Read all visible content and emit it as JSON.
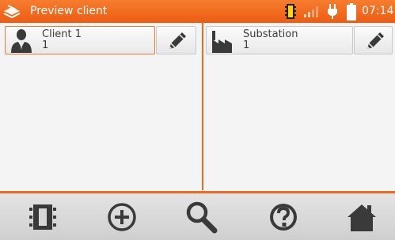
{
  "header": {
    "title": "Preview client",
    "clock": "07:14",
    "logo_icon": "app-logo-icon",
    "status_icons": [
      "memory-card-icon",
      "signal-strength-icon",
      "power-plug-icon",
      "battery-icon"
    ]
  },
  "left_panel": {
    "card": {
      "name": "Client 1",
      "value": "1",
      "icon": "person-icon",
      "selected": true
    },
    "edit_icon": "pencil-icon"
  },
  "right_panel": {
    "card": {
      "name": "Substation",
      "value": "1",
      "icon": "factory-icon",
      "selected": false
    },
    "edit_icon": "pencil-icon"
  },
  "toolbar": {
    "items": [
      "memory-icon",
      "add-icon",
      "search-icon",
      "help-icon",
      "home-icon"
    ]
  },
  "colors": {
    "accent": "#ec5c12",
    "divider": "#ef6a1f",
    "selected_border": "#ee7c33",
    "icon": "#3a3a3a"
  }
}
